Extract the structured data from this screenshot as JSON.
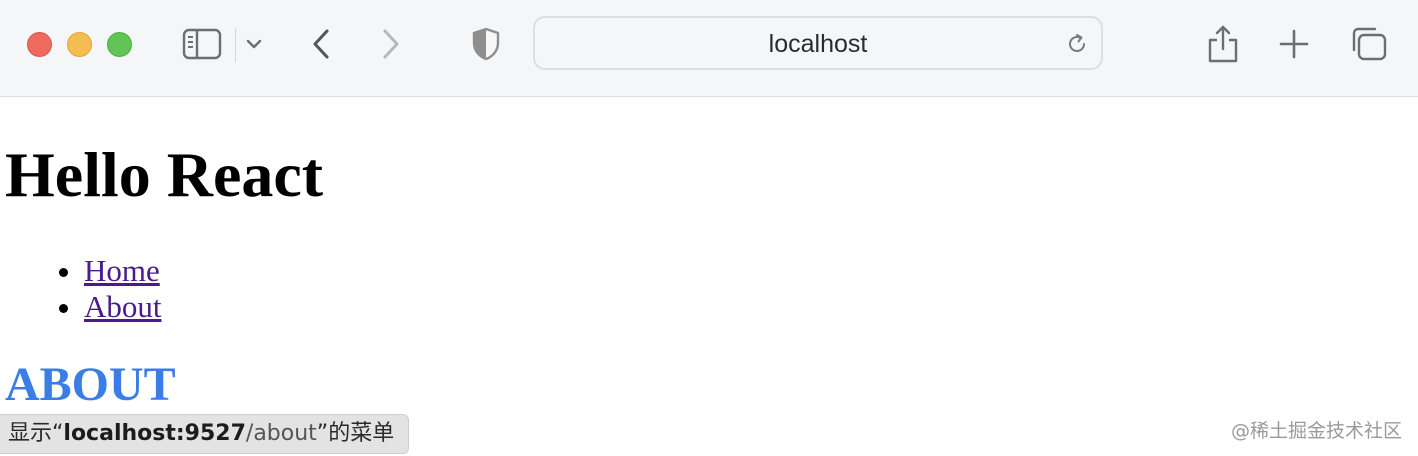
{
  "browser": {
    "address": "localhost",
    "icons": {
      "sidebar": "sidebar-icon",
      "sidebar_menu": "chevron-down-icon",
      "back": "chevron-left-icon",
      "forward": "chevron-right-icon",
      "privacy": "shield-icon",
      "reload": "reload-icon",
      "share": "share-icon",
      "new_tab": "plus-icon",
      "tab_overview": "tabs-icon"
    },
    "colors": {
      "close": "#ee6a5f",
      "minimize": "#f5bd4f",
      "zoom": "#61c454"
    }
  },
  "page": {
    "title": "Hello React",
    "nav": [
      {
        "label": "Home"
      },
      {
        "label": "About"
      }
    ],
    "section_heading": "ABOUT",
    "colors": {
      "link": "#4a1b8c",
      "section_heading": "#3a7de6"
    }
  },
  "status_bar": {
    "prefix": "显示“",
    "host": "localhost:9527",
    "path": "/about",
    "suffix": "”的菜单"
  },
  "watermark": "@稀土掘金技术社区"
}
